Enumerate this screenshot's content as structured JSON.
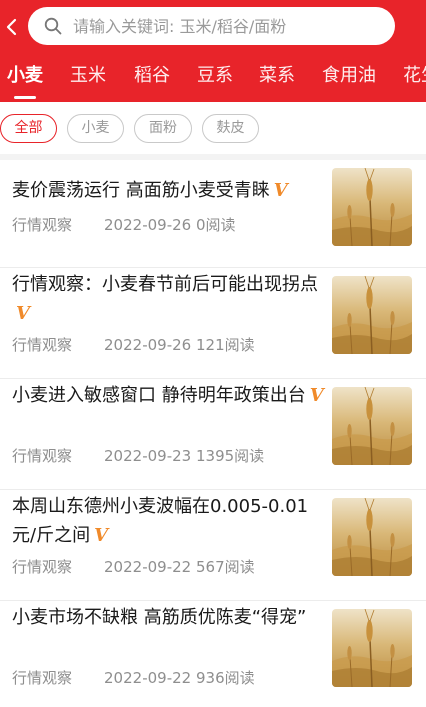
{
  "colors": {
    "brand": "#e8242a",
    "vip_badge": "#f08a2a"
  },
  "header": {
    "back_icon": "chevron-left-icon",
    "search": {
      "icon": "search-icon",
      "placeholder": "请输入关键词: 玉米/稻谷/面粉",
      "value": ""
    }
  },
  "tabs": [
    {
      "label": "小麦",
      "active": true
    },
    {
      "label": "玉米"
    },
    {
      "label": "稻谷"
    },
    {
      "label": "豆系"
    },
    {
      "label": "菜系"
    },
    {
      "label": "食用油"
    },
    {
      "label": "花生"
    }
  ],
  "filters": [
    {
      "label": "全部",
      "active": true
    },
    {
      "label": "小麦"
    },
    {
      "label": "面粉"
    },
    {
      "label": "麸皮"
    }
  ],
  "articles": [
    {
      "title": "麦价震荡运行 高面筋小麦受青睐",
      "badge": "V",
      "category": "行情观察",
      "date": "2022-09-26",
      "reads": "0阅读",
      "thumb_icon": "wheat-image"
    },
    {
      "title": "行情观察：小麦春节前后可能出现拐点",
      "badge": "V",
      "category": "行情观察",
      "date": "2022-09-26",
      "reads": "121阅读",
      "thumb_icon": "wheat-image"
    },
    {
      "title": "小麦进入敏感窗口 静待明年政策出台",
      "badge": "V",
      "category": "行情观察",
      "date": "2022-09-23",
      "reads": "1395阅读",
      "thumb_icon": "wheat-image"
    },
    {
      "title": "本周山东德州小麦波幅在0.005-0.01元/斤之间",
      "badge": "V",
      "category": "行情观察",
      "date": "2022-09-22",
      "reads": "567阅读",
      "thumb_icon": "wheat-image"
    },
    {
      "title": "小麦市场不缺粮 高筋质优陈麦“得宠”",
      "badge": "",
      "category": "行情观察",
      "date": "2022-09-22",
      "reads": "936阅读",
      "thumb_icon": "wheat-image"
    }
  ]
}
